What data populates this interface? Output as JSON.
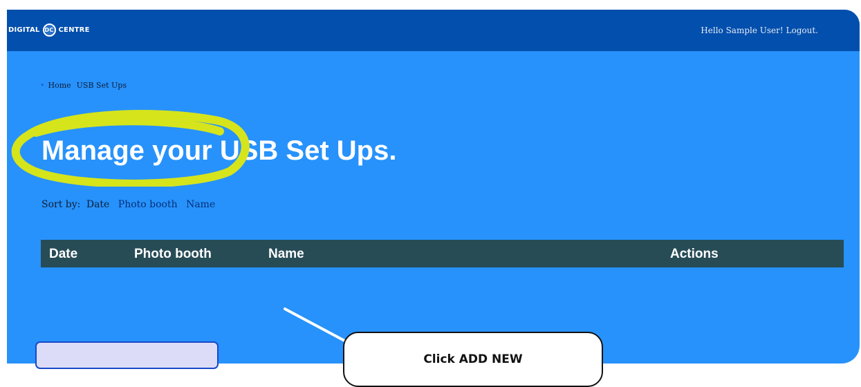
{
  "header": {
    "logo_left": "DIGITAL",
    "logo_badge": "DC",
    "logo_right": "CENTRE",
    "greeting": "Hello Sample User!",
    "logout": "Logout."
  },
  "breadcrumb": {
    "home": "Home",
    "current": "USB Set Ups"
  },
  "page": {
    "title": "Manage your USB Set Ups."
  },
  "sort": {
    "label": "Sort by:",
    "options": [
      "Date",
      "Photo booth",
      "Name"
    ]
  },
  "table": {
    "columns": [
      "Date",
      "Photo booth",
      "Name",
      "Actions"
    ]
  },
  "annotation": {
    "callout": "Click ADD NEW",
    "highlight_color": "#d6e41c"
  },
  "colors": {
    "topbar": "#034fad",
    "background": "#2792fb",
    "table_header": "#274c56"
  }
}
